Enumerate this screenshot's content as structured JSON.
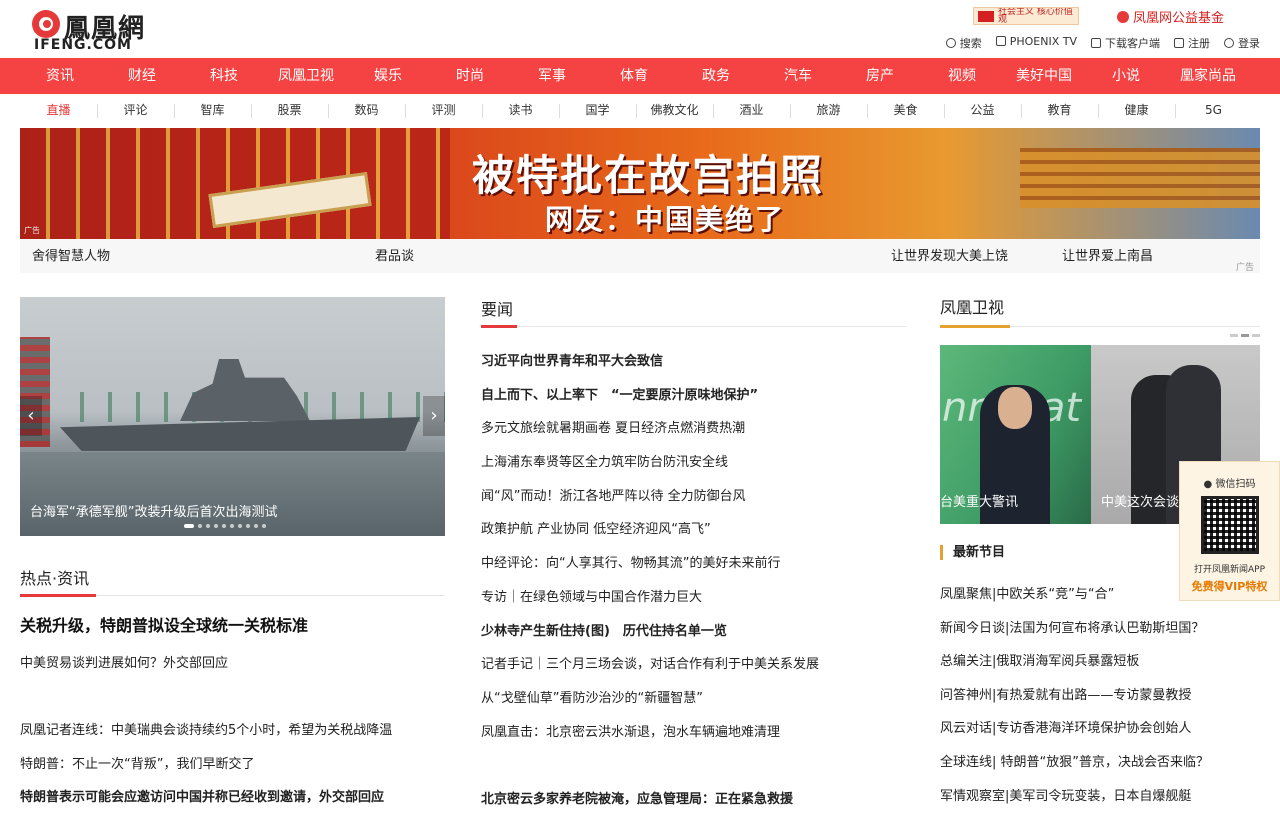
{
  "header": {
    "logo_cn": "鳳凰網",
    "logo_en": "IFENG.COM",
    "banner1": "社会主义 核心价值观",
    "banner2": "凤凰网公益基金",
    "links": [
      "搜索",
      "PHOENIX TV",
      "下载客户端",
      "注册",
      "登录"
    ]
  },
  "nav_primary": [
    "资讯",
    "财经",
    "科技",
    "凤凰卫视",
    "娱乐",
    "时尚",
    "军事",
    "体育",
    "政务",
    "汽车",
    "房产",
    "视频",
    "美好中国",
    "小说",
    "凰家尚品"
  ],
  "nav_secondary": [
    "直播",
    "评论",
    "智库",
    "股票",
    "数码",
    "评测",
    "读书",
    "国学",
    "佛教文化",
    "酒业",
    "旅游",
    "美食",
    "公益",
    "教育",
    "健康",
    "5G"
  ],
  "ad_banner": {
    "headline": "被特批在故宫拍照",
    "subline": "网友：中国美绝了",
    "tag": "广告"
  },
  "promo_links": [
    "舍得智慧人物",
    "君品谈",
    "让世界发现大美上饶",
    "让世界爱上南昌"
  ],
  "promo_ad_tag": "广告",
  "slider": {
    "caption": "台海军“承德军舰”改装升级后首次出海测试",
    "prev": "‹",
    "next": "›"
  },
  "hot": {
    "title": "热点·资讯",
    "headline": "关税升级，特朗普拟设全球统一关税标准",
    "items": [
      {
        "text": "中美贸易谈判进展如何？外交部回应",
        "bold": false
      },
      {
        "text": "",
        "bold": false
      },
      {
        "text": "凤凰记者连线：中美瑞典会谈持续约5个小时，希望为关税战降温",
        "bold": false
      },
      {
        "text": "特朗普：不止一次“背叛”，我们早断交了",
        "bold": false
      },
      {
        "text": "特朗普表示可能会应邀访问中国并称已经收到邀请，外交部回应",
        "bold": true
      }
    ]
  },
  "news": {
    "title": "要闻",
    "items": [
      {
        "text": "习近平向世界青年和平大会致信",
        "bold": true
      },
      {
        "text": "自上而下、以上率下　“一定要原汁原味地保护”",
        "bold": true
      },
      {
        "text": "多元文旅绘就暑期画卷 夏日经济点燃消费热潮",
        "bold": false
      },
      {
        "text": "上海浦东奉贤等区全力筑牢防台防汛安全线",
        "bold": false
      },
      {
        "text": "闻“风”而动！浙江各地严阵以待 全力防御台风",
        "bold": false
      },
      {
        "text": "政策护航 产业协同 低空经济迎风“高飞”",
        "bold": false
      },
      {
        "text": "中经评论：向“人享其行、物畅其流”的美好未来前行",
        "bold": false
      },
      {
        "text": "专访｜在绿色领域与中国合作潜力巨大",
        "bold": false
      },
      {
        "text": "少林寺产生新住持(图)　历代住持名单一览",
        "bold": true
      },
      {
        "text": "记者手记｜三个月三场会谈，对话合作有利于中美关系发展",
        "bold": false
      },
      {
        "text": "从“戈壁仙草”看防沙治沙的“新疆智慧”",
        "bold": false
      },
      {
        "text": "凤凰直击：北京密云洪水渐退，泡水车辆遍地难清理",
        "bold": false
      },
      {
        "text": "",
        "bold": false
      },
      {
        "text": "北京密云多家养老院被淹，应急管理局：正在紧急救援",
        "bold": true
      }
    ]
  },
  "phoenix_tv": {
    "title": "凤凰卫视",
    "slide_captions": [
      "台美重大警讯",
      "中美这次会谈"
    ],
    "slide_text": "nnovat",
    "latest_title": "最新节目",
    "items": [
      "凤凰聚焦|中欧关系“竞”与“合”",
      "新闻今日谈|法国为何宣布将承认巴勒斯坦国？",
      "总编关注|俄取消海军阅兵暴露短板",
      "问答神州|有热爱就有出路——专访蒙曼教授",
      "风云对话|专访香港海洋环境保护协会创始人",
      "全球连线| 特朗普“放狠”普京，决战会否来临？",
      "军情观察室|美军司令玩变装，日本自爆舰艇"
    ]
  },
  "qr_popup": {
    "header": "微信扫码",
    "line1": "打开凤凰新闻APP",
    "line2": "免费得VIP特权"
  }
}
